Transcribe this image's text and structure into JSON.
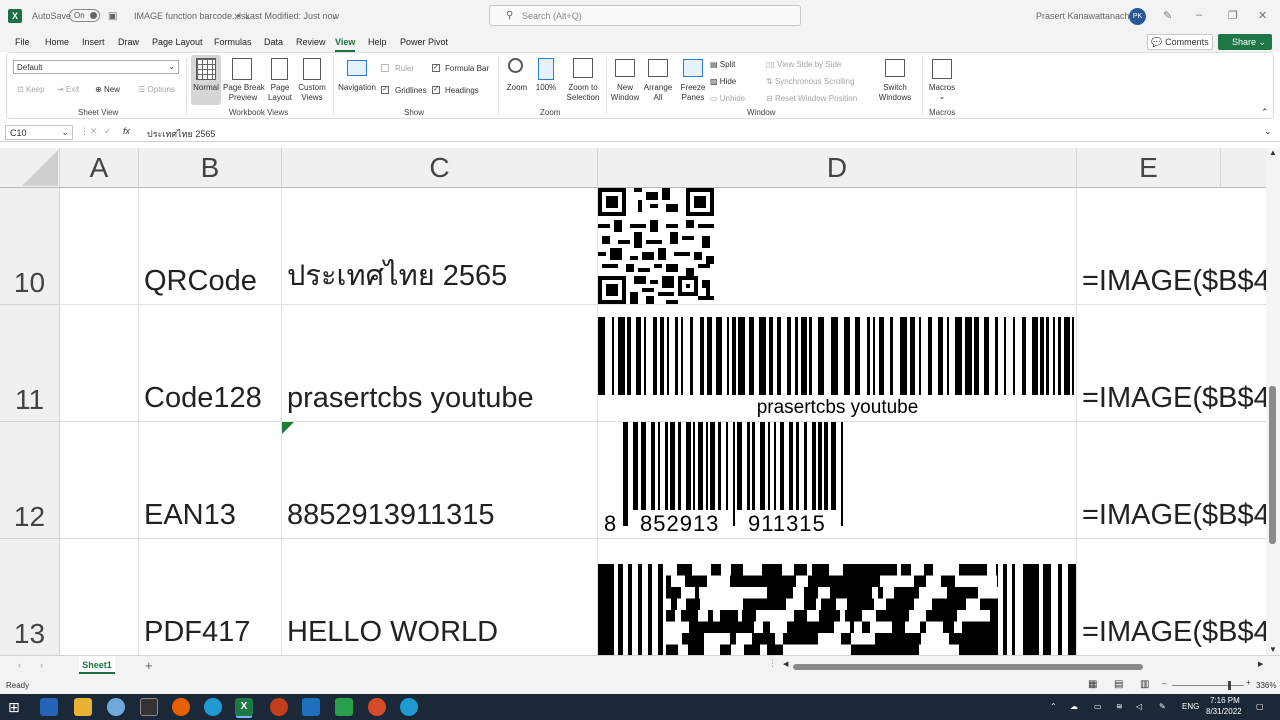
{
  "titlebar": {
    "autosave_label": "AutoSave",
    "autosave_state": "On",
    "filename": "IMAGE function barcode.xlsx",
    "dot": "•",
    "modified": "Last Modified: Just now",
    "search_placeholder": "Search (Alt+Q)",
    "user_name": "Prasert Kanawattanachai",
    "user_initials": "PK"
  },
  "menu": {
    "items": [
      "File",
      "Home",
      "Insert",
      "Draw",
      "Page Layout",
      "Formulas",
      "Data",
      "Review",
      "View",
      "Help",
      "Power Pivot"
    ],
    "active": "View",
    "comments_label": "Comments",
    "share_label": "Share"
  },
  "ribbon": {
    "sheet_view": {
      "select_value": "Default",
      "keep": "Keep",
      "exit": "Exit",
      "new": "New",
      "options": "Options",
      "group": "Sheet View"
    },
    "workbook_views": {
      "normal": "Normal",
      "page_break": "Page Break",
      "preview": "Preview",
      "page": "Page",
      "layout": "Layout",
      "custom": "Custom",
      "views": "Views",
      "group": "Workbook Views"
    },
    "show": {
      "navigation": "Navigation",
      "ruler": "Ruler",
      "formula_bar": "Formula Bar",
      "gridlines": "Gridlines",
      "headings": "Headings",
      "group": "Show"
    },
    "zoom": {
      "zoom": "Zoom",
      "hundred": "100%",
      "zoom_to": "Zoom to",
      "selection": "Selection",
      "group": "Zoom"
    },
    "window": {
      "new": "New",
      "window": "Window",
      "arrange": "Arrange",
      "all": "All",
      "freeze": "Freeze",
      "panes": "Panes",
      "split": "Split",
      "hide": "Hide",
      "unhide": "Unhide",
      "side_by_side": "View Side by Side",
      "sync_scroll": "Synchronous Scrolling",
      "reset_pos": "Reset Window Position",
      "switch": "Switch",
      "windows": "Windows",
      "group": "Window"
    },
    "macros": {
      "label": "Macros",
      "group": "Macros"
    }
  },
  "formula_bar": {
    "name_box": "C10",
    "fx": "fx",
    "formula": "ประเทศไทย 2565"
  },
  "grid": {
    "columns": [
      "A",
      "B",
      "C",
      "D",
      "E"
    ],
    "rows": [
      {
        "num": "10",
        "b": "QRCode",
        "c": "ประเทศไทย 2565",
        "e": "=IMAGE($B$4"
      },
      {
        "num": "11",
        "b": "Code128",
        "c": "prasertcbs youtube",
        "e": "=IMAGE($B$4"
      },
      {
        "num": "12",
        "b": "EAN13",
        "c": "8852913911315",
        "e": "=IMAGE($B$4"
      },
      {
        "num": "13",
        "b": "PDF417",
        "c": "HELLO WORLD",
        "e": "=IMAGE($B$4"
      }
    ],
    "code128_caption": "prasertcbs youtube",
    "ean_digits": [
      "8",
      "852913",
      "911315"
    ]
  },
  "sheet_tabs": {
    "active": "Sheet1"
  },
  "status": {
    "ready": "Ready",
    "zoom": "336%"
  },
  "taskbar": {
    "lang": "ENG",
    "time": "7:16 PM",
    "date": "8/31/2022"
  }
}
